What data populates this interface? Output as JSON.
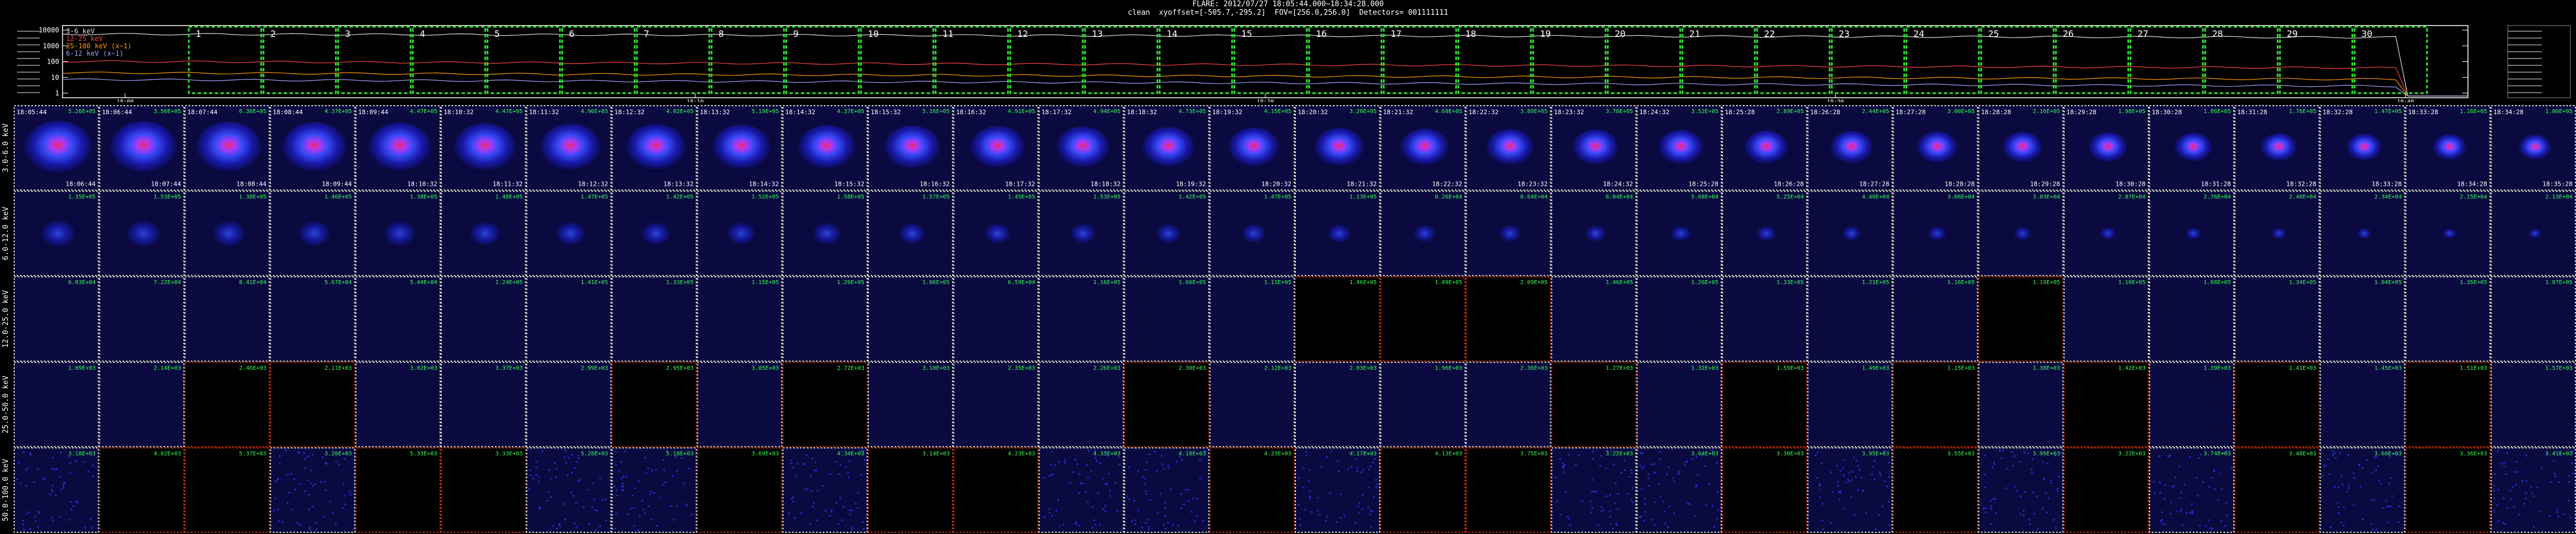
{
  "header": {
    "line1": "FLARE: 2012/07/27 18:05:44.000~18:34:28.000",
    "line2": "clean  xyoffset=[-505.7,-295.2]  FOV=[256.0,256.0]  Detectors= 001111111"
  },
  "lightcurve": {
    "legend": [
      "3-6 keV",
      "12-25 keV",
      "25-100 keV (x~1)",
      "6-12 keV (x~1)"
    ],
    "legend_colors": [
      "#dddddd",
      "#ff4040",
      "#ff9900",
      "#a0a0ff"
    ],
    "y_ticks": [
      "10000",
      "1000",
      "100",
      "10",
      "1"
    ],
    "x_ticks": [
      "18:00",
      "18:10",
      "18:20",
      "18:30",
      "18:40"
    ],
    "interval_labels": [
      "1",
      "2",
      "3",
      "4",
      "5",
      "6",
      "7",
      "8",
      "9",
      "10",
      "11",
      "12",
      "13",
      "14",
      "15",
      "16",
      "17",
      "18",
      "19",
      "20",
      "21",
      "22",
      "23",
      "24",
      "25",
      "26",
      "27",
      "28",
      "29",
      "30"
    ]
  },
  "energy_bands": [
    "3.0-6.0 keV",
    "6.0-12.0 keV",
    "12.0-25.0 keV",
    "25.0-50.0 keV",
    "50.0-100.0 keV"
  ],
  "start_times": [
    "18:05:44",
    "18:06:44",
    "18:07:44",
    "18:08:44",
    "18:09:44",
    "18:10:32",
    "18:11:32",
    "18:12:32",
    "18:13:32",
    "18:14:32",
    "18:15:32",
    "18:16:32",
    "18:17:32",
    "18:18:32",
    "18:19:32",
    "18:20:32",
    "18:21:32",
    "18:22:32",
    "18:23:32",
    "18:24:32",
    "18:25:28",
    "18:26:28",
    "18:27:28",
    "18:28:28",
    "18:29:28",
    "18:30:28",
    "18:31:28",
    "18:32:28",
    "18:33:28",
    "18:34:28"
  ],
  "end_times": [
    "18:06:44",
    "18:07:44",
    "18:08:44",
    "18:09:44",
    "18:10:32",
    "18:11:32",
    "18:12:32",
    "18:13:32",
    "18:14:32",
    "18:15:32",
    "18:16:32",
    "18:17:32",
    "18:18:32",
    "18:19:32",
    "18:20:32",
    "18:21:32",
    "18:22:32",
    "18:23:32",
    "18:24:32",
    "18:25:28",
    "18:26:28",
    "18:27:28",
    "18:28:28",
    "18:29:28",
    "18:30:28",
    "18:31:28",
    "18:32:28",
    "18:33:28",
    "18:34:28",
    "18:35:28"
  ],
  "row_values": [
    [
      "5.26E+05",
      "3.56E+05",
      "6.36E+05",
      "4.37E+05",
      "4.47E+05",
      "4.47E+05",
      "4.96E+05",
      "4.02E+05",
      "5.19E+05",
      "4.37E+05",
      "5.16E+05",
      "4.91E+05",
      "4.94E+05",
      "4.73E+05",
      "4.15E+05",
      "3.20E+05",
      "4.69E+05",
      "3.89E+05",
      "3.78E+05",
      "3.52E+05",
      "2.89E+05",
      "2.44E+05",
      "3.00E+05",
      "2.16E+05",
      "1.98E+05",
      "1.86E+05",
      "1.76E+05",
      "1.47E+05",
      "1.16E+05",
      "1.06E+05"
    ],
    [
      "1.35E+05",
      "1.53E+05",
      "1.38E+05",
      "1.46E+05",
      "1.38E+05",
      "1.48E+05",
      "1.47E+05",
      "1.42E+05",
      "1.52E+05",
      "1.58E+05",
      "1.57E+05",
      "1.45E+05",
      "1.53E+05",
      "1.42E+05",
      "1.47E+05",
      "1.13E+05",
      "8.26E+04",
      "8.64E+04",
      "6.84E+04",
      "5.68E+04",
      "5.25E+04",
      "4.40E+04",
      "3.66E+04",
      "3.03E+04",
      "2.87E+04",
      "2.76E+04",
      "2.40E+04",
      "2.34E+04",
      "2.15E+04",
      "2.13E+04"
    ],
    [
      "6.03E+04",
      "7.22E+04",
      "8.41E+04",
      "5.67E+04",
      "5.44E+04",
      "1.24E+05",
      "1.41E+05",
      "1.33E+05",
      "1.15E+05",
      "1.26E+05",
      "1.06E+05",
      "6.59E+04",
      "1.16E+05",
      "1.66E+05",
      "1.11E+05",
      "1.46E+05",
      "1.09E+05",
      "2.09E+05",
      "1.46E+05",
      "1.26E+05",
      "1.33E+05",
      "1.21E+05",
      "1.16E+05",
      "1.19E+05",
      "1.10E+05",
      "1.08E+05",
      "1.34E+05",
      "1.04E+05",
      "1.35E+05",
      "1.07E+05"
    ],
    [
      "1.09E+03",
      "2.14E+03",
      "2.46E+03",
      "2.11E+03",
      "3.02E+03",
      "3.37E+03",
      "2.99E+03",
      "2.95E+03",
      "3.05E+03",
      "2.72E+03",
      "3.10E+03",
      "2.35E+03",
      "2.26E+03",
      "2.30E+03",
      "2.12E+03",
      "2.03E+03",
      "1.96E+03",
      "2.36E+03",
      "1.27E+03",
      "1.32E+03",
      "1.59E+03",
      "1.49E+03",
      "1.15E+03",
      "1.38E+03",
      "1.42E+03",
      "1.39E+03",
      "1.41E+03",
      "1.45E+03",
      "1.51E+03",
      "1.57E+03"
    ],
    [
      "3.18E+03",
      "4.02E+03",
      "5.37E+03",
      "3.20E+03",
      "5.33E+03",
      "3.33E+03",
      "5.28E+03",
      "5.18E+03",
      "3.69E+03",
      "4.34E+03",
      "3.14E+03",
      "4.23E+03",
      "4.33E+03",
      "4.18E+03",
      "4.23E+03",
      "4.17E+03",
      "4.13E+03",
      "3.75E+03",
      "3.22E+03",
      "3.64E+03",
      "3.30E+03",
      "3.95E+03",
      "3.55E+03",
      "3.99E+03",
      "3.22E+03",
      "3.74E+03",
      "3.48E+03",
      "3.60E+03",
      "3.36E+03",
      "3.41E+03"
    ]
  ],
  "row_image_state": [
    [
      "img",
      "img",
      "img",
      "img",
      "img",
      "img",
      "img",
      "img",
      "img",
      "img",
      "img",
      "img",
      "img",
      "img",
      "img",
      "img",
      "img",
      "img",
      "img",
      "img",
      "img",
      "img",
      "img",
      "img",
      "img",
      "img",
      "img",
      "img",
      "img",
      "img"
    ],
    [
      "img",
      "img",
      "img",
      "img",
      "img",
      "img",
      "img",
      "img",
      "img",
      "img",
      "img",
      "img",
      "img",
      "img",
      "img",
      "img",
      "img",
      "img",
      "img",
      "img",
      "img",
      "img",
      "img",
      "img",
      "img",
      "img",
      "img",
      "img",
      "img",
      "img"
    ],
    [
      "dark",
      "dark",
      "dark",
      "dark",
      "dark",
      "dark",
      "dark",
      "dark",
      "dark",
      "dark",
      "dark",
      "dark",
      "dark",
      "dark",
      "dark",
      "black",
      "black",
      "black",
      "dark",
      "dark",
      "dark",
      "dark",
      "dark",
      "black",
      "dark",
      "dark",
      "dark",
      "dark",
      "dark",
      "dark"
    ],
    [
      "dark",
      "dark",
      "black",
      "black",
      "dark",
      "dark",
      "dark",
      "black",
      "dark",
      "black",
      "dark",
      "dark",
      "dark",
      "black",
      "dark",
      "dark",
      "dark",
      "dark",
      "black",
      "dark",
      "black",
      "dark",
      "black",
      "dark",
      "black",
      "dark",
      "black",
      "dark",
      "black",
      "dark"
    ],
    [
      "noise",
      "black",
      "black",
      "noise",
      "black",
      "black",
      "noise",
      "noise",
      "black",
      "noise",
      "black",
      "black",
      "noise",
      "noise",
      "black",
      "noise",
      "black",
      "black",
      "noise",
      "noise",
      "black",
      "noise",
      "black",
      "noise",
      "black",
      "noise",
      "black",
      "noise",
      "black",
      "noise"
    ]
  ]
}
